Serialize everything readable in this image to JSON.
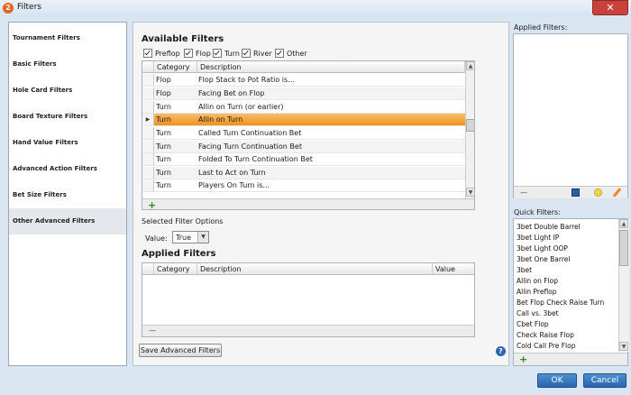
{
  "window": {
    "title": "Filters",
    "app_icon": "2",
    "close_glyph": "✕"
  },
  "nav": {
    "items": [
      {
        "label": "Tournament Filters"
      },
      {
        "label": "Basic Filters"
      },
      {
        "label": "Hole Card Filters"
      },
      {
        "label": "Board Texture Filters"
      },
      {
        "label": "Hand Value Filters"
      },
      {
        "label": "Advanced Action Filters"
      },
      {
        "label": "Bet Size Filters"
      },
      {
        "label": "Other Advanced Filters"
      }
    ],
    "active_index": 7
  },
  "available": {
    "heading": "Available Filters",
    "streets": [
      {
        "label": "Preflop",
        "checked": true
      },
      {
        "label": "Flop",
        "checked": true
      },
      {
        "label": "Turn",
        "checked": true
      },
      {
        "label": "River",
        "checked": true
      },
      {
        "label": "Other",
        "checked": true
      }
    ],
    "columns": {
      "category": "Category",
      "description": "Description"
    },
    "rows": [
      {
        "category": "Flop",
        "description": "Flop Stack to Pot Ratio is..."
      },
      {
        "category": "Flop",
        "description": "Facing Bet on Flop"
      },
      {
        "category": "Turn",
        "description": "Allin on Turn (or earlier)"
      },
      {
        "category": "Turn",
        "description": "Allin on Turn"
      },
      {
        "category": "Turn",
        "description": "Called Turn Continuation Bet"
      },
      {
        "category": "Turn",
        "description": "Facing Turn Continuation Bet"
      },
      {
        "category": "Turn",
        "description": "Folded To Turn Continuation Bet"
      },
      {
        "category": "Turn",
        "description": "Last to Act on Turn"
      },
      {
        "category": "Turn",
        "description": "Players On Turn is..."
      }
    ],
    "selected_index": 3,
    "add_glyph": "+"
  },
  "options": {
    "heading": "Selected Filter Options",
    "value_label": "Value:",
    "value": "True",
    "dropdown_glyph": "▼"
  },
  "applied_center": {
    "heading": "Applied Filters",
    "columns": {
      "category": "Category",
      "description": "Description",
      "value": "Value"
    },
    "remove_glyph": "—"
  },
  "save_button": "Save Advanced Filters",
  "help_glyph": "?",
  "right": {
    "applied_label": "Applied Filters:",
    "quick_label": "Quick Filters:",
    "remove_glyph": "—",
    "add_glyph": "+",
    "quick_items": [
      "3bet Double Barrel",
      "3bet Light IP",
      "3bet Light OOP",
      "3bet One Barrel",
      "3bet",
      "Allin on Flop",
      "Allin Preflop",
      "Bet Flop Check Raise Turn",
      "Call vs. 3bet",
      "Cbet Flop",
      "Check Raise Flop",
      "Cold Call Pre Flop"
    ]
  },
  "footer": {
    "ok": "OK",
    "cancel": "Cancel"
  },
  "colors": {
    "accent_orange": "#f2901c",
    "button_blue": "#2a66ad",
    "close_red": "#c8423b"
  }
}
